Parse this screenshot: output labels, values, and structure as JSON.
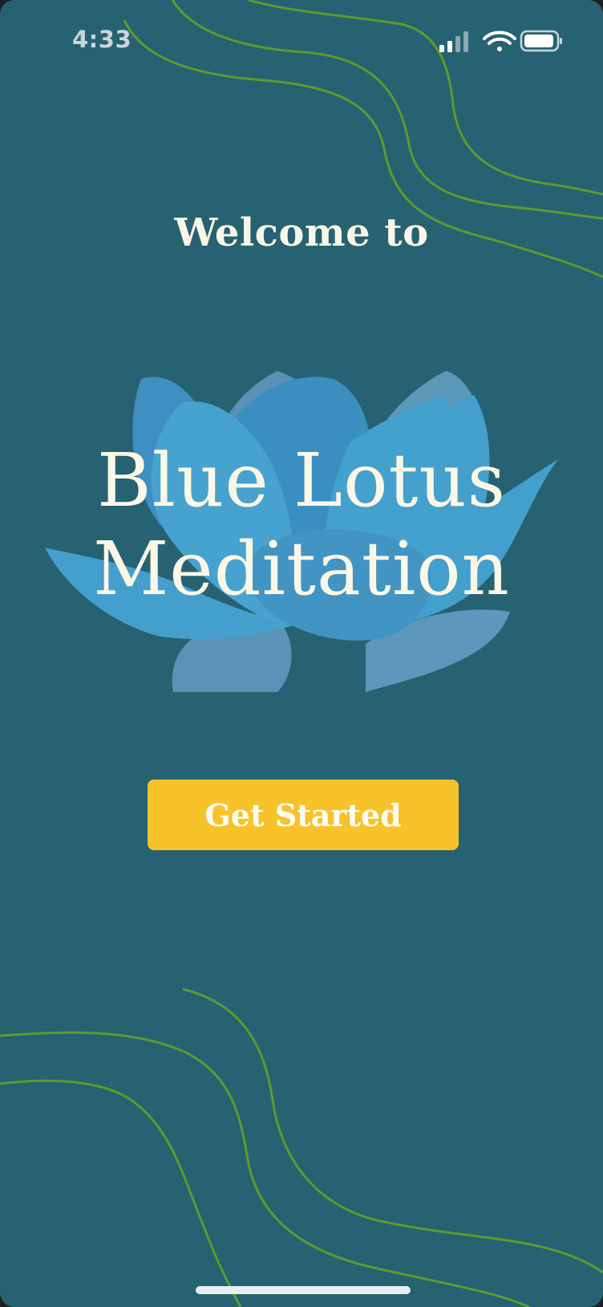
{
  "status_bar": {
    "time": "4:33"
  },
  "welcome": {
    "heading": "Welcome to"
  },
  "logo": {
    "line1": "Blue Lotus",
    "line2": "Meditation"
  },
  "actions": {
    "get_started_label": "Get Started"
  },
  "colors": {
    "background": "#266272",
    "button": "#f8c22b",
    "wave_lines": "#5f9a2e",
    "text": "#fbf7e6"
  },
  "icons": [
    "signal-icon",
    "wifi-icon",
    "battery-icon",
    "lotus-logo"
  ]
}
